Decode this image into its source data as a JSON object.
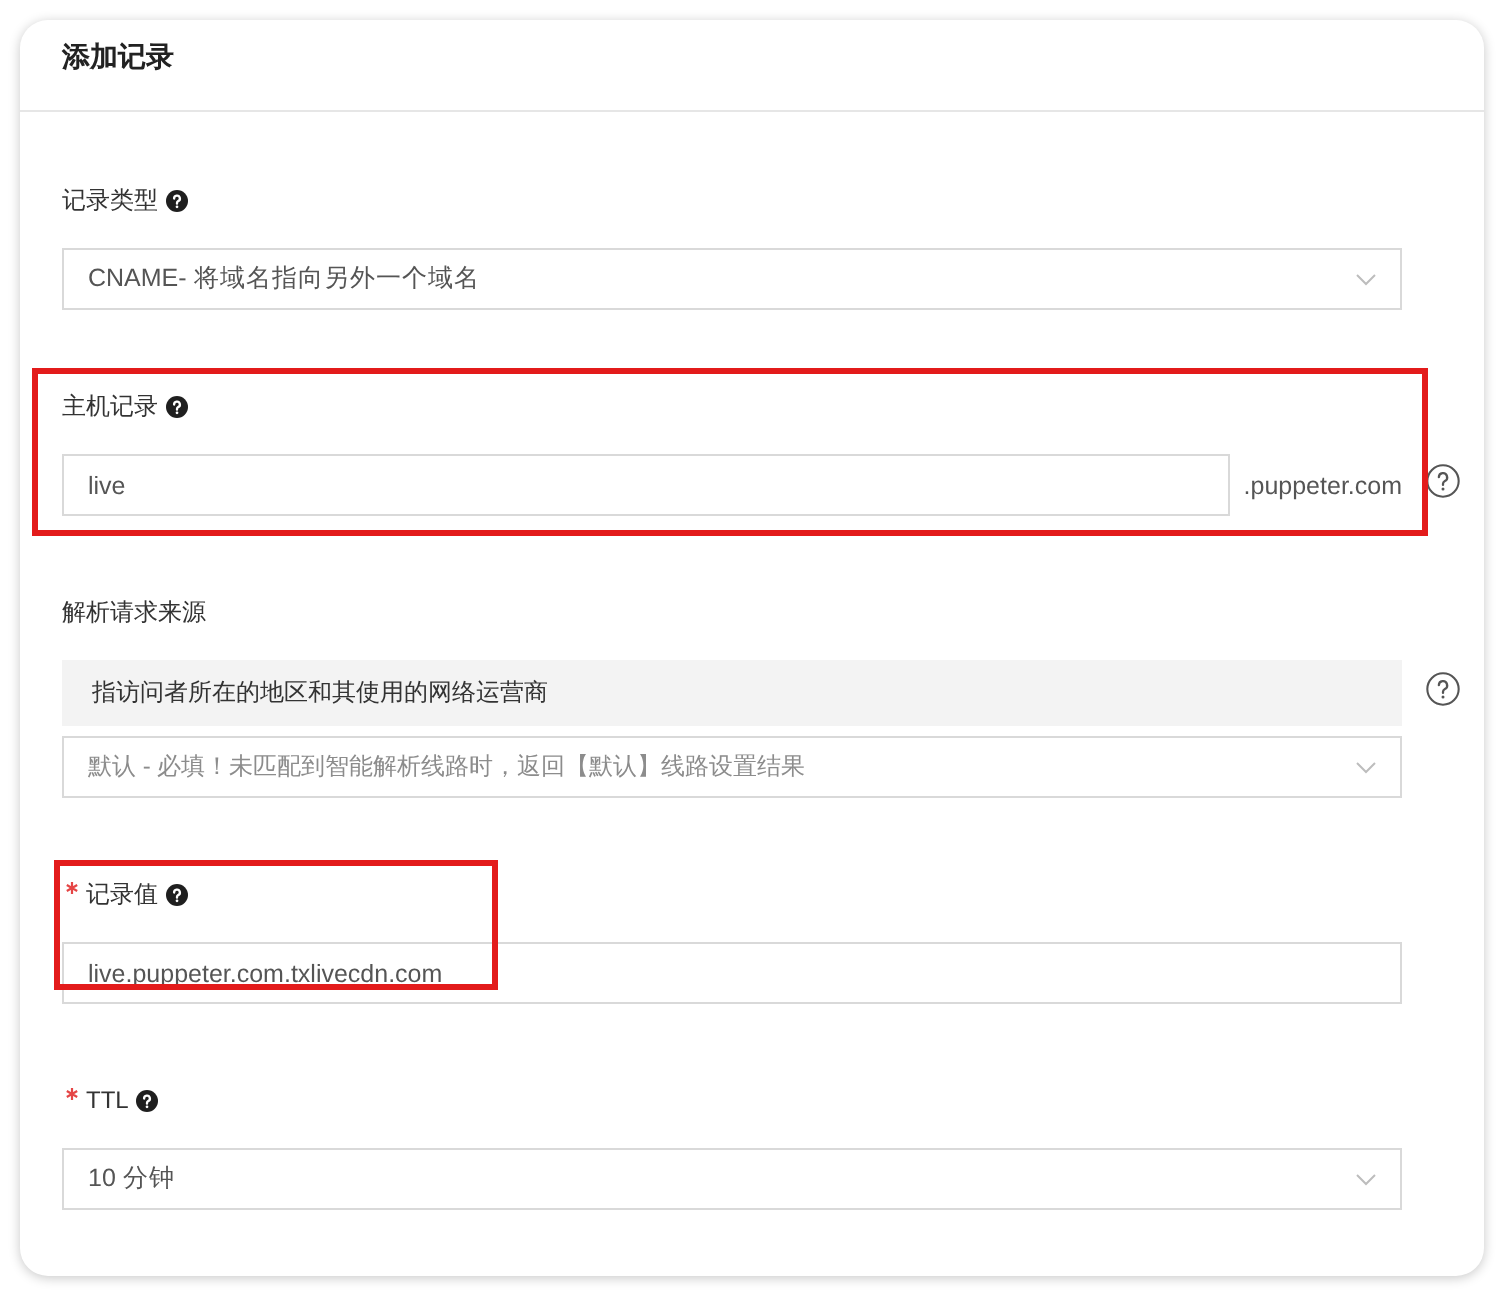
{
  "dialog": {
    "title": "添加记录"
  },
  "fields": [
    {
      "kind": "select",
      "label": "记录类型",
      "required": false,
      "help_icon": true,
      "side_help_icon": false,
      "highlighted": false,
      "value": "CNAME- 将域名指向另外一个域名"
    },
    {
      "kind": "suffix-input",
      "label": "主机记录",
      "required": false,
      "help_icon": true,
      "side_help_icon": true,
      "highlighted": true,
      "value": "live",
      "suffix": ".puppeter.com"
    },
    {
      "kind": "select",
      "label": "解析请求来源",
      "required": false,
      "help_icon": false,
      "side_help_icon": true,
      "highlighted": false,
      "note": "指访问者所在的地区和其使用的网络运营商",
      "placeholder": "默认 - 必填！未匹配到智能解析线路时，返回【默认】线路设置结果"
    },
    {
      "kind": "input",
      "label": "记录值",
      "required": true,
      "help_icon": true,
      "side_help_icon": false,
      "highlighted": true,
      "value": "live.puppeter.com.txlivecdn.com"
    },
    {
      "kind": "select",
      "label": "TTL",
      "required": true,
      "help_icon": true,
      "side_help_icon": false,
      "highlighted": false,
      "value": "10 分钟"
    }
  ]
}
